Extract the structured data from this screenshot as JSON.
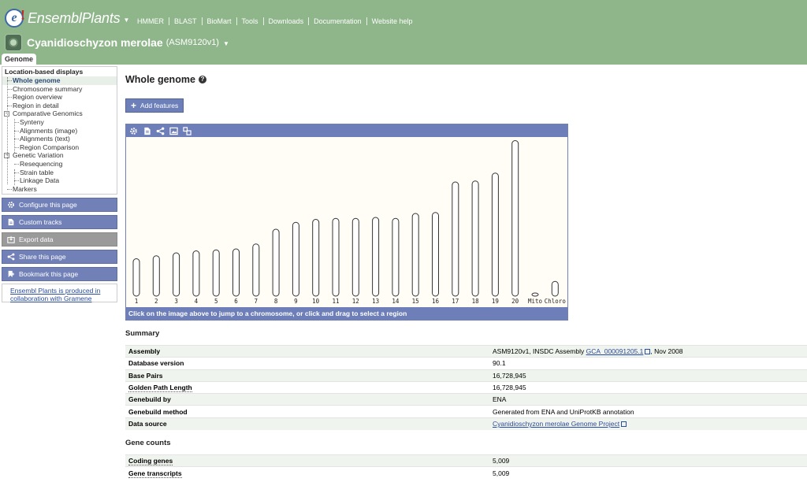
{
  "brand": {
    "name": "EnsemblPlants",
    "caret": "▼"
  },
  "topnav": [
    "HMMER",
    "BLAST",
    "BioMart",
    "Tools",
    "Downloads",
    "Documentation",
    "Website help"
  ],
  "species": {
    "name": "Cyanidioschyzon merolae",
    "assembly": "(ASM9120v1)",
    "caret": "▼"
  },
  "tab": {
    "label": "Genome"
  },
  "sidebar": {
    "heading": "Location-based displays",
    "items": [
      {
        "label": "Whole genome",
        "level": 1,
        "active": true
      },
      {
        "label": "Chromosome summary",
        "level": 1
      },
      {
        "label": "Region overview",
        "level": 1
      },
      {
        "label": "Region in detail",
        "level": 1
      },
      {
        "label": "Comparative Genomics",
        "level": 1,
        "toggle": "−"
      },
      {
        "label": "Synteny",
        "level": 2
      },
      {
        "label": "Alignments (image)",
        "level": 2
      },
      {
        "label": "Alignments (text)",
        "level": 2
      },
      {
        "label": "Region Comparison",
        "level": 2
      },
      {
        "label": "Genetic Variation",
        "level": 1,
        "toggle": "−"
      },
      {
        "label": "Resequencing",
        "level": 2
      },
      {
        "label": "Strain table",
        "level": 2
      },
      {
        "label": "Linkage Data",
        "level": 2
      },
      {
        "label": "Markers",
        "level": 1
      }
    ],
    "actions": [
      {
        "label": "Configure this page",
        "icon": "gear-icon"
      },
      {
        "label": "Custom tracks",
        "icon": "custom-tracks-icon"
      },
      {
        "label": "Export data",
        "icon": "export-icon",
        "disabled": true
      },
      {
        "label": "Share this page",
        "icon": "share-icon"
      },
      {
        "label": "Bookmark this page",
        "icon": "bookmark-icon"
      }
    ],
    "collab": {
      "line1": "Ensembl Plants is produced in",
      "line2": "collaboration with Gramene"
    }
  },
  "main": {
    "title": "Whole genome",
    "add_features": "Add features",
    "karyotype_footer": "Click on the image above to jump to a chromosome, or click and drag to select a region",
    "summary_title": "Summary",
    "summary": [
      {
        "key": "Assembly",
        "value_pre": "ASM9120v1, INSDC Assembly ",
        "link": "GCA_000091205.1",
        "value_post": ", Nov 2008"
      },
      {
        "key": "Database version",
        "value": "90.1"
      },
      {
        "key": "Base Pairs",
        "value": "16,728,945"
      },
      {
        "key": "Golden Path Length",
        "value": "16,728,945",
        "dotted": true
      },
      {
        "key": "Genebuild by",
        "value": "ENA"
      },
      {
        "key": "Genebuild method",
        "value": "Generated from ENA and UniProtKB annotation"
      },
      {
        "key": "Data source",
        "link": "Cyanidioschyzon merolae Genome Project"
      }
    ],
    "gene_counts_title": "Gene counts",
    "gene_counts": [
      {
        "key": "Coding genes",
        "value": "5,009",
        "dotted": true
      },
      {
        "key": "Gene transcripts",
        "value": "5,009",
        "dotted": true
      }
    ]
  },
  "chart_data": {
    "type": "bar",
    "categories": [
      "1",
      "2",
      "3",
      "4",
      "5",
      "6",
      "7",
      "8",
      "9",
      "10",
      "11",
      "12",
      "13",
      "14",
      "15",
      "16",
      "17",
      "18",
      "19",
      "20",
      "Mito",
      "Chloro"
    ],
    "values": [
      0.38,
      0.41,
      0.44,
      0.46,
      0.47,
      0.48,
      0.53,
      0.68,
      0.75,
      0.78,
      0.79,
      0.79,
      0.8,
      0.79,
      0.84,
      0.85,
      1.16,
      1.17,
      1.25,
      1.58,
      0.03,
      0.15
    ],
    "ylabel": "",
    "xlabel": "",
    "title": "",
    "ylim": [
      0,
      1.6
    ]
  }
}
